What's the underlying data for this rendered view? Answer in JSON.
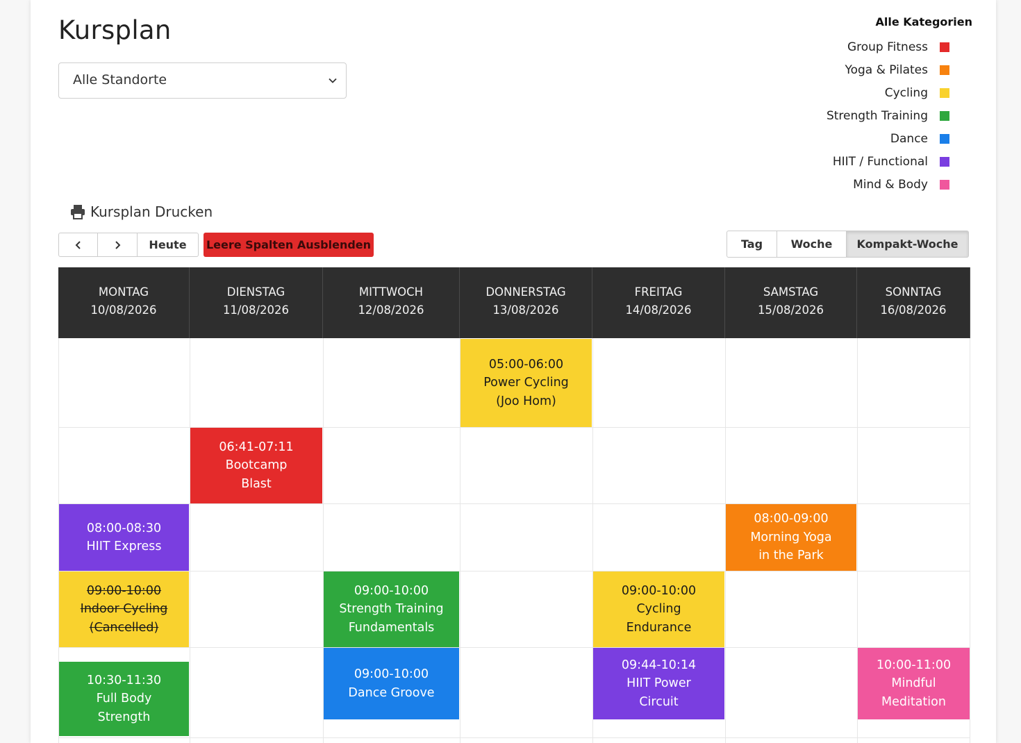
{
  "page": {
    "title": "Kursplan"
  },
  "location_select": {
    "value": "Alle Standorte"
  },
  "legend": {
    "title": "Alle Kategorien",
    "items": [
      {
        "label": "Group Fitness",
        "color": "#e42b2b"
      },
      {
        "label": "Yoga & Pilates",
        "color": "#f7820f"
      },
      {
        "label": "Cycling",
        "color": "#f9d22e"
      },
      {
        "label": "Strength Training",
        "color": "#2fa83e"
      },
      {
        "label": "Dance",
        "color": "#1a7fe9"
      },
      {
        "label": "HIIT / Functional",
        "color": "#7a3ee0"
      },
      {
        "label": "Mind & Body",
        "color": "#f0579d"
      }
    ]
  },
  "toolbar": {
    "print_label": "Kursplan Drucken",
    "prev_label": "‹",
    "next_label": "›",
    "today_label": "Heute",
    "hide_empty_label": "Leere Spalten Ausblenden",
    "views": {
      "day": "Tag",
      "week": "Woche",
      "compact": "Kompakt-Woche"
    },
    "active_view": "Kompakt-Woche"
  },
  "days": [
    {
      "name": "MONTAG",
      "date": "10/08/2026"
    },
    {
      "name": "DIENSTAG",
      "date": "11/08/2026"
    },
    {
      "name": "MITTWOCH",
      "date": "12/08/2026"
    },
    {
      "name": "DONNERSTAG",
      "date": "13/08/2026"
    },
    {
      "name": "FREITAG",
      "date": "14/08/2026"
    },
    {
      "name": "SAMSTAG",
      "date": "15/08/2026"
    },
    {
      "name": "SONNTAG",
      "date": "16/08/2026"
    }
  ],
  "events": [
    {
      "day": 3,
      "time": "05:00-06:00",
      "title": "Power Cycling",
      "extra": "(Joo Hom)",
      "category": "Cycling",
      "cancelled": false
    },
    {
      "day": 1,
      "time": "06:41-07:11",
      "title": "Bootcamp",
      "extra": "Blast",
      "category": "Group Fitness",
      "cancelled": false
    },
    {
      "day": 0,
      "time": "08:00-08:30",
      "title": "HIIT Express",
      "extra": "",
      "category": "HIIT / Functional",
      "cancelled": false
    },
    {
      "day": 5,
      "time": "08:00-09:00",
      "title": "Morning Yoga",
      "extra": "in the Park",
      "category": "Yoga & Pilates",
      "cancelled": false
    },
    {
      "day": 0,
      "time": "09:00-10:00",
      "title": "Indoor Cycling",
      "extra": "(Cancelled)",
      "category": "Cycling",
      "cancelled": true
    },
    {
      "day": 2,
      "time": "09:00-10:00",
      "title": "Strength Training",
      "extra": "Fundamentals",
      "category": "Strength Training",
      "cancelled": false
    },
    {
      "day": 4,
      "time": "09:00-10:00",
      "title": "Cycling",
      "extra": "Endurance",
      "category": "Cycling",
      "cancelled": false
    },
    {
      "day": 2,
      "time": "09:00-10:00",
      "title": "Dance Groove",
      "extra": "",
      "category": "Dance",
      "cancelled": false
    },
    {
      "day": 4,
      "time": "09:44-10:14",
      "title": "HIIT Power",
      "extra": "Circuit",
      "category": "HIIT / Functional",
      "cancelled": false
    },
    {
      "day": 6,
      "time": "10:00-11:00",
      "title": "Mindful",
      "extra": "Meditation",
      "category": "Mind & Body",
      "cancelled": false
    },
    {
      "day": 0,
      "time": "10:30-11:30",
      "title": "Full Body",
      "extra": "Strength",
      "category": "Strength Training",
      "cancelled": false
    }
  ]
}
